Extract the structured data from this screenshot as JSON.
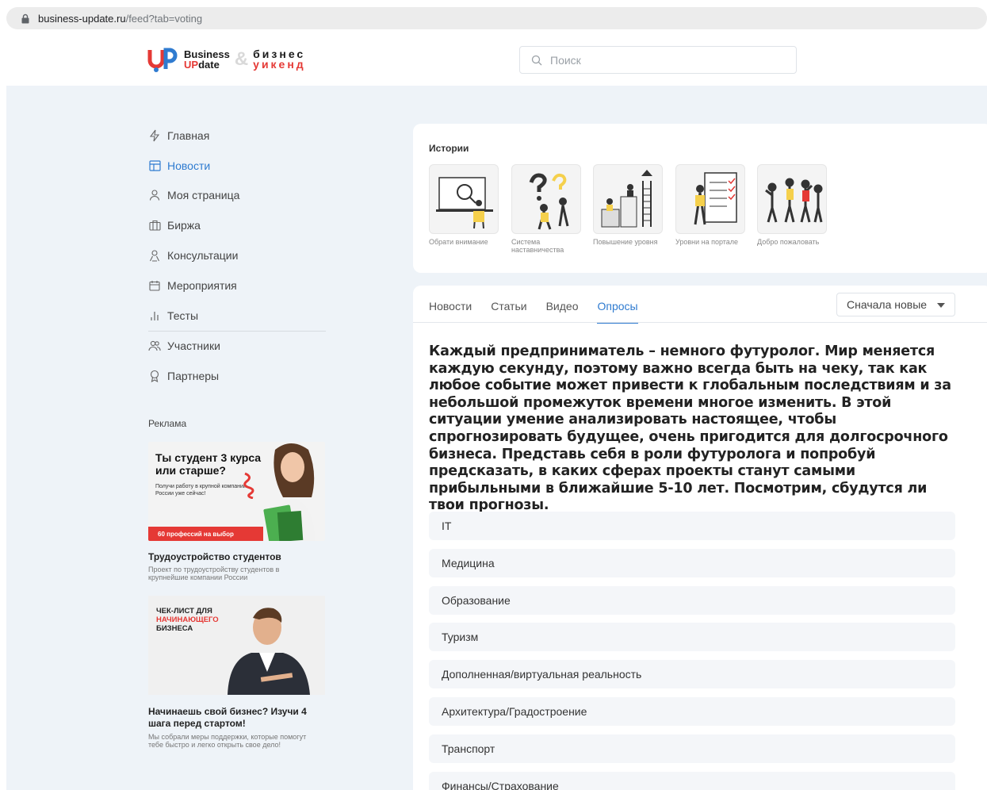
{
  "browser": {
    "url_host": "business-update.ru",
    "url_path": "/feed?tab=voting"
  },
  "header": {
    "logo_business": "Business",
    "logo_up": "UP",
    "logo_date": "date",
    "logo_amp": "&",
    "logo_biznes": "бизнес",
    "logo_weekend": "уикенд",
    "search_placeholder": "Поиск"
  },
  "sidebar": {
    "items": [
      {
        "label": "Главная",
        "icon": "lightning-icon"
      },
      {
        "label": "Новости",
        "icon": "news-icon",
        "active": true
      },
      {
        "label": "Моя страница",
        "icon": "user-icon"
      },
      {
        "label": "Биржа",
        "icon": "briefcase-icon"
      },
      {
        "label": "Консультации",
        "icon": "consult-icon"
      },
      {
        "label": "Мероприятия",
        "icon": "calendar-icon"
      },
      {
        "label": "Тесты",
        "icon": "bars-icon"
      },
      {
        "label": "Участники",
        "icon": "users-icon"
      },
      {
        "label": "Партнеры",
        "icon": "award-icon"
      }
    ]
  },
  "ads": {
    "title": "Реклама",
    "ad1": {
      "banner_title": "Ты студент 3 курса или старше?",
      "banner_sub": "Получи работу в крупной компании России уже сейчас!",
      "banner_strip": "60 профессий на выбор",
      "title": "Трудоустройство студентов",
      "desc": "Проект по трудоустройству студентов в крупнейшие компании России"
    },
    "ad2": {
      "banner_line1": "ЧЕК-ЛИСТ ДЛЯ",
      "banner_line2": "НАЧИНАЮЩЕГО",
      "banner_line3": "БИЗНЕСА",
      "title": "Начинаешь свой бизнес? Изучи 4 шага перед стартом!",
      "desc": "Мы собрали меры поддержки, которые помогут тебе быстро и легко открыть свое дело!"
    }
  },
  "stories": {
    "label": "Истории",
    "items": [
      {
        "caption": "Обрати внимание"
      },
      {
        "caption": "Система наставничества"
      },
      {
        "caption": "Повышение уровня"
      },
      {
        "caption": "Уровни на портале"
      },
      {
        "caption": "Добро пожаловать"
      }
    ]
  },
  "feed": {
    "tabs": [
      "Новости",
      "Статьи",
      "Видео",
      "Опросы"
    ],
    "active_tab": "Опросы",
    "sort_label": "Сначала новые",
    "question": "Каждый предприниматель – немного футуролог. Мир меняется каждую секунду, поэтому важно всегда быть на чеку, так как любое событие может привести к глобальным последствиям и за небольшой промежуток времени многое изменить. В этой ситуации умение анализировать настоящее, чтобы спрогнозировать будущее, очень пригодится для долгосрочного бизнеса. Представь себя в роли футуролога и попробуй предсказать, в каких сферах проекты станут самыми прибыльными в ближайшие 5-10 лет. Посмотрим, сбудутся ли твои прогнозы.",
    "options": [
      "IT",
      "Медицина",
      "Образование",
      "Туризм",
      "Дополненная/виртуальная реальность",
      "Архитектура/Градостроение",
      "Транспорт",
      "Финансы/Страхование"
    ]
  },
  "colors": {
    "accent": "#2f7bd0",
    "brand_red": "#e53935",
    "page_bg": "#eef3f8"
  }
}
